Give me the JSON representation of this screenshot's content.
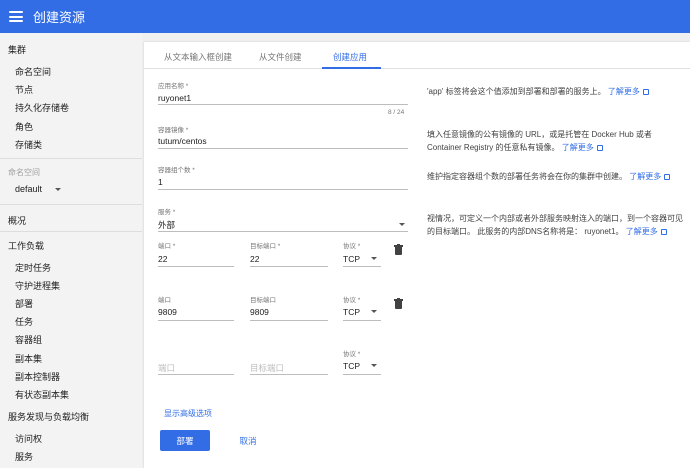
{
  "header": {
    "title": "创建资源"
  },
  "sidebar": {
    "cluster": "集群",
    "cluster_items": [
      "命名空间",
      "节点",
      "持久化存储卷",
      "角色",
      "存储类"
    ],
    "namespace_label": "命名空间",
    "namespace_value": "default",
    "overview": "概况",
    "workloads": "工作负载",
    "workload_items": [
      "定时任务",
      "守护进程集",
      "部署",
      "任务",
      "容器组",
      "副本集",
      "副本控制器",
      "有状态副本集"
    ],
    "discovery": "服务发现与负载均衡",
    "discovery_items": [
      "访问权",
      "服务"
    ]
  },
  "tabs": [
    "从文本输入框创建",
    "从文件创建",
    "创建应用"
  ],
  "form": {
    "app_name_label": "应用名称 *",
    "app_name_value": "ruyonet1",
    "app_name_counter": "8 / 24",
    "image_label": "容器镜像 *",
    "image_value": "tutum/centos",
    "pods_label": "容器组个数 *",
    "pods_value": "1",
    "service_label": "服务 *",
    "service_value": "外部",
    "ports": [
      {
        "port_label": "端口 *",
        "port": "22",
        "target_label": "目标端口 *",
        "target": "22",
        "protocol_label": "协议 *",
        "protocol": "TCP"
      },
      {
        "port_label": "端口",
        "port": "9809",
        "target_label": "目标端口",
        "target": "9809",
        "protocol_label": "协议 *",
        "protocol": "TCP"
      }
    ],
    "empty_port": {
      "port_placeholder": "端口",
      "target_placeholder": "目标端口",
      "protocol_label": "协议 *",
      "protocol": "TCP"
    },
    "advanced_link": "显示高级选项",
    "deploy_button": "部署",
    "cancel_button": "取消"
  },
  "help": {
    "app_name": "'app' 标签将会这个值添加到部署和部署的服务上。",
    "image": "填入任意镜像的公有镜像的 URL，或是托管在 Docker Hub 或者 Container Registry 的任意私有镜像。",
    "pods": "维护指定容器组个数的部署任务将会在你的集群中创建。",
    "service": "视情况，可定义一个内部或者外部服务映射连入的端口，到一个容器可见的目标端口。 此服务的内部DNS名称将是： ruyonet1。",
    "learn_more": "了解更多"
  },
  "colors": {
    "primary": "#326de6",
    "sidebar_bg": "#f3f3f3"
  }
}
